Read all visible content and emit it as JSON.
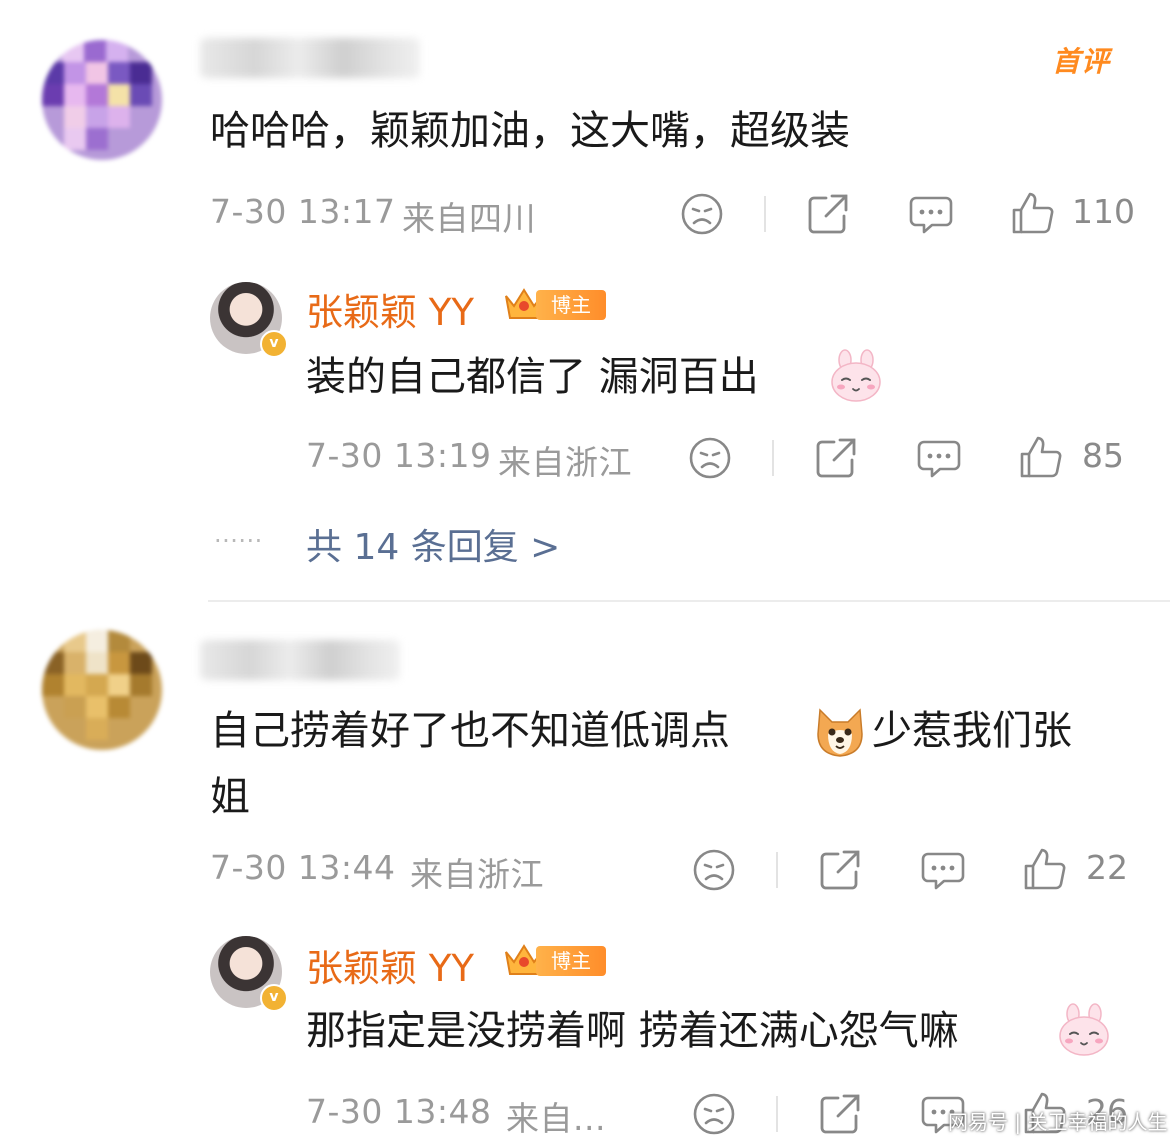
{
  "comments": [
    {
      "text": "哈哈哈，颖颖加油，这大嘴，超级装",
      "time": "7-30 13:17",
      "location": "来自四川",
      "likes": "110",
      "badge": "首评",
      "reply": {
        "author": "张颖颖 YY",
        "badge": "博主",
        "text": "装的自己都信了 漏洞百出",
        "time": "7-30 13:19",
        "location": "来自浙江",
        "likes": "85"
      },
      "more_replies": "共 14 条回复 >"
    },
    {
      "text_line1": "自己捞着好了也不知道低调点",
      "text_line1b": "少惹我们张",
      "text_line2": "姐",
      "time": "7-30 13:44",
      "location": "来自浙江",
      "likes": "22",
      "reply": {
        "author": "张颖颖 YY",
        "badge": "博主",
        "text": "那指定是没捞着啊 捞着还满心怨气嘛",
        "time": "7-30 13:48",
        "location": "来自...",
        "likes": "26"
      }
    }
  ],
  "more_dots": "......",
  "watermark": "网易号 | 关卫幸福的人生",
  "colors": {
    "author": "#e86a17",
    "link": "#5a6f93",
    "meta": "#9a9a9a",
    "badge": "#ff8d2a"
  }
}
